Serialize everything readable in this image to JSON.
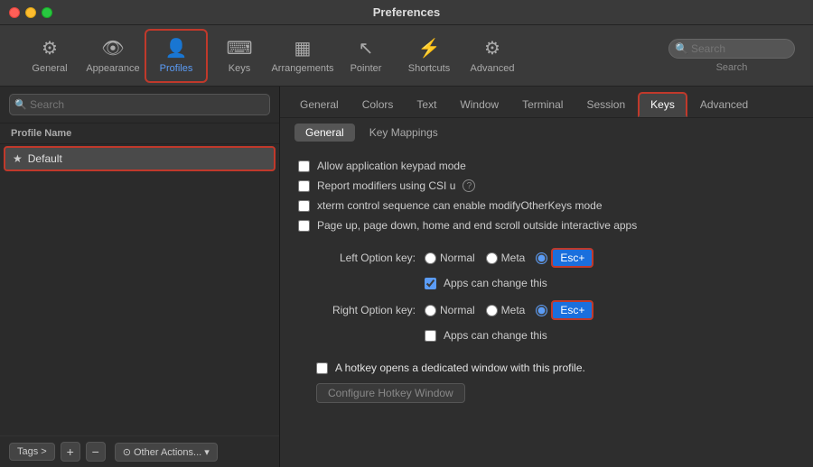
{
  "window": {
    "title": "Preferences"
  },
  "toolbar": {
    "items": [
      {
        "id": "general",
        "label": "General",
        "icon": "⚙"
      },
      {
        "id": "appearance",
        "label": "Appearance",
        "icon": "👁"
      },
      {
        "id": "profiles",
        "label": "Profiles",
        "icon": "👤",
        "active": true
      },
      {
        "id": "keys",
        "label": "Keys",
        "icon": "⌨"
      },
      {
        "id": "arrangements",
        "label": "Arrangements",
        "icon": "▦"
      },
      {
        "id": "pointer",
        "label": "Pointer",
        "icon": "↖"
      },
      {
        "id": "shortcuts",
        "label": "Shortcuts",
        "icon": "⚡"
      },
      {
        "id": "advanced",
        "label": "Advanced",
        "icon": "⚙"
      }
    ],
    "search": {
      "placeholder": "Search",
      "label": "Search"
    }
  },
  "sidebar": {
    "search_placeholder": "Search",
    "column_header": "Profile Name",
    "profiles": [
      {
        "id": "default",
        "name": "Default",
        "star": true,
        "selected": true
      }
    ],
    "footer": {
      "tags_label": "Tags >",
      "add_icon": "+",
      "remove_icon": "−",
      "other_actions_label": "⊙ Other Actions...",
      "dropdown_icon": "▾"
    }
  },
  "content": {
    "tabs1": [
      {
        "id": "general",
        "label": "General"
      },
      {
        "id": "colors",
        "label": "Colors"
      },
      {
        "id": "text",
        "label": "Text"
      },
      {
        "id": "window",
        "label": "Window"
      },
      {
        "id": "terminal",
        "label": "Terminal"
      },
      {
        "id": "session",
        "label": "Session"
      },
      {
        "id": "keys",
        "label": "Keys",
        "active": true
      },
      {
        "id": "advanced",
        "label": "Advanced"
      }
    ],
    "tabs2": [
      {
        "id": "general",
        "label": "General",
        "active": true
      },
      {
        "id": "key_mappings",
        "label": "Key Mappings"
      }
    ],
    "checkboxes": [
      {
        "id": "keypad",
        "label": "Allow application keypad mode",
        "checked": false
      },
      {
        "id": "modifiers",
        "label": "Report modifiers using CSI u",
        "checked": false,
        "has_help": true
      },
      {
        "id": "xterm",
        "label": "xterm control sequence can enable modifyOtherKeys mode",
        "checked": false
      },
      {
        "id": "pageup",
        "label": "Page up, page down, home and end scroll outside interactive apps",
        "checked": false
      }
    ],
    "left_option_key": {
      "label": "Left Option key:",
      "options": [
        "Normal",
        "Meta",
        "Esc+"
      ],
      "selected": "Esc+",
      "apps_can_change": true,
      "apps_can_change_label": "Apps can change this"
    },
    "right_option_key": {
      "label": "Right Option key:",
      "options": [
        "Normal",
        "Meta",
        "Esc+"
      ],
      "selected": "Esc+",
      "apps_can_change": false,
      "apps_can_change_label": "Apps can change this"
    },
    "hotkey": {
      "checkbox_label": "A hotkey opens a dedicated window with this profile.",
      "checked": false,
      "configure_btn_label": "Configure Hotkey Window"
    }
  }
}
